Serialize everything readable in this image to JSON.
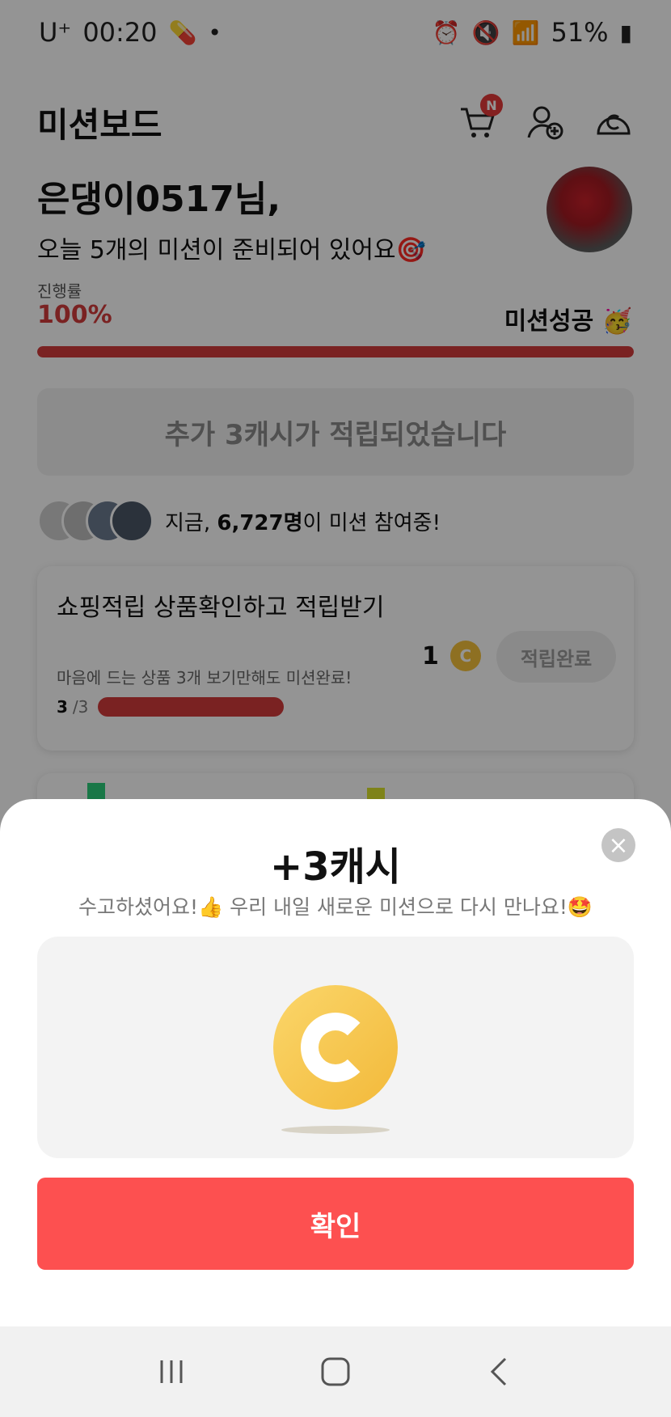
{
  "status_bar": {
    "carrier": "U⁺",
    "time": "00:20",
    "battery": "51%",
    "icons": [
      "pill-icon",
      "dot-icon",
      "alarm-icon",
      "mute-icon",
      "wifi-icon",
      "signal-icon",
      "battery-icon"
    ]
  },
  "header": {
    "title": "미션보드",
    "cart_badge": "N",
    "icons": [
      "cart-icon",
      "add-friend-icon",
      "cash-icon"
    ]
  },
  "greeting": {
    "name": "은댕이0517님,",
    "subtitle": "오늘 5개의 미션이 준비되어 있어요🎯"
  },
  "progress": {
    "label": "진행률",
    "value_text": "100%",
    "fraction": 1.0,
    "status": "미션성공 🥳"
  },
  "banner": {
    "text": "추가 3캐시가 적립되었습니다"
  },
  "participants": {
    "prefix": "지금, ",
    "count": "6,727명",
    "suffix": "이 미션 참여중!"
  },
  "mission": {
    "title": "쇼핑적립 상품확인하고 적립받기",
    "desc": "마음에 드는 상품 3개 보기만해도 미션완료!",
    "progress_current": "3",
    "progress_total": "/3",
    "progress_fraction": 1.0,
    "reward": "1",
    "button": "적립완료"
  },
  "sheet": {
    "title": "+3캐시",
    "subtitle": "수고하셨어요!👍 우리 내일 새로운 미션으로 다시 만나요!🤩",
    "confirm": "확인"
  },
  "colors": {
    "accent_red": "#d23c3c",
    "confirm_button": "#fd5050",
    "coin": "#f2b93a"
  }
}
